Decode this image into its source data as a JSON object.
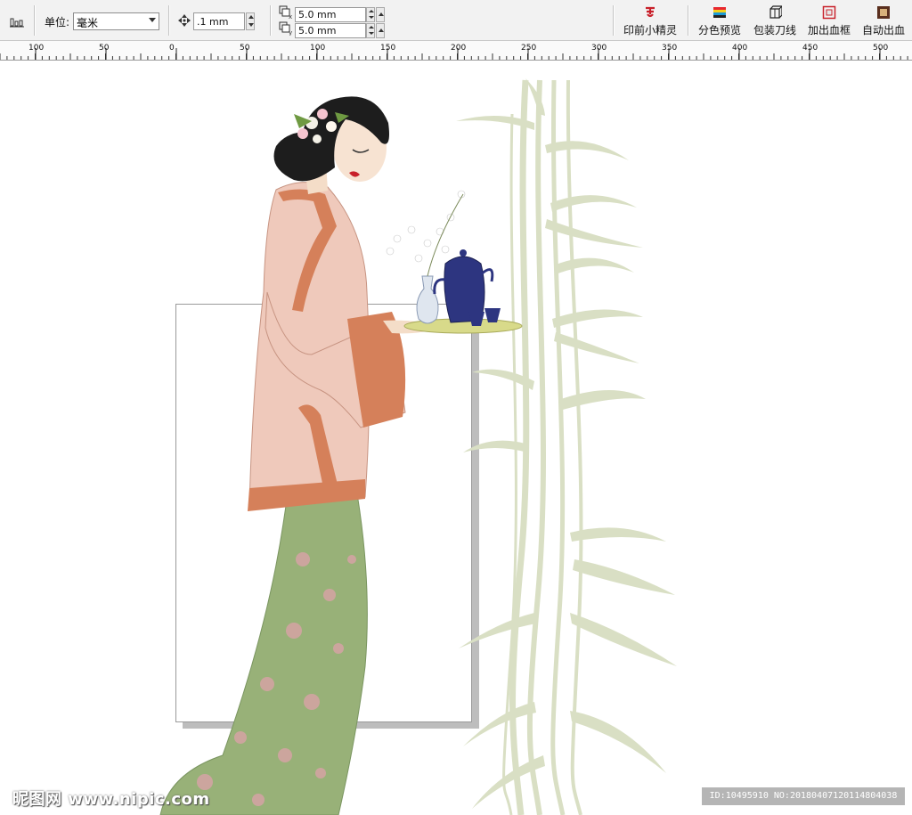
{
  "propbar": {
    "units_label": "单位:",
    "units_value": "毫米",
    "nudge_value": ".1 mm",
    "dup_x_value": "5.0 mm",
    "dup_y_value": "5.0 mm",
    "tools": [
      {
        "name": "preprint-wizard",
        "label": "印前小精灵",
        "icon": "stamp-icon"
      },
      {
        "name": "separation-preview",
        "label": "分色预览",
        "icon": "color-bars-icon"
      },
      {
        "name": "packaging-cutline",
        "label": "包装刀线",
        "icon": "box-cutline-icon"
      },
      {
        "name": "add-bleed-frame",
        "label": "加出血框",
        "icon": "bleed-frame-icon"
      },
      {
        "name": "auto-bleed",
        "label": "自动出血",
        "icon": "auto-bleed-icon"
      }
    ]
  },
  "ruler": {
    "labels": [
      "100",
      "50",
      "0",
      "50",
      "100",
      "150",
      "200",
      "250",
      "300",
      "350",
      "400",
      "450",
      "500"
    ]
  },
  "watermark": {
    "left": "昵图网 www.nipic.com",
    "right": "ID:10495910 NO:20180407120114804038"
  },
  "colors": {
    "accent_red": "#c8202a",
    "bamboo": "#d9dfc4",
    "skirt_green": "#98b178",
    "jacket_pink": "#efc9bb",
    "trim_orange": "#d5805a",
    "teapot_blue": "#2d3580"
  }
}
